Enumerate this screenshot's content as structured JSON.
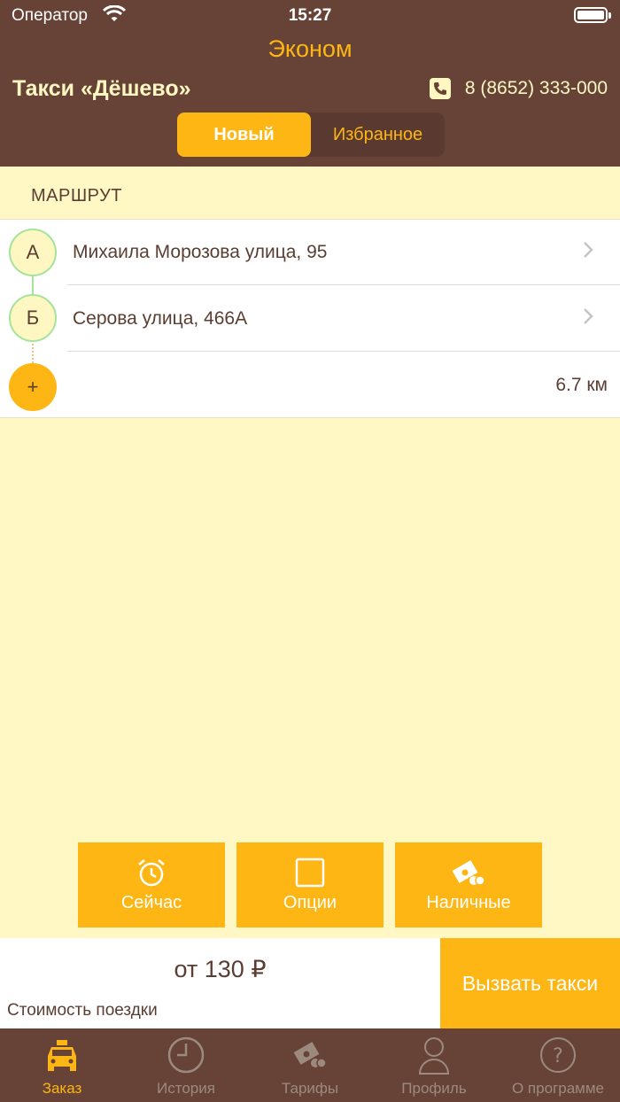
{
  "status_bar": {
    "carrier": "Оператор",
    "time": "15:27"
  },
  "header": {
    "tariff_title": "Эконом",
    "company": "Такси «Дёшево»",
    "phone": "8 (8652) 333-000",
    "segments": [
      {
        "label": "Новый",
        "active": true
      },
      {
        "label": "Избранное",
        "active": false
      }
    ]
  },
  "route": {
    "section_title": "МАРШРУТ",
    "points": [
      {
        "marker": "А",
        "address": "Михаила Морозова улица, 95"
      },
      {
        "marker": "Б",
        "address": "Серова улица, 466А"
      }
    ],
    "add_marker": "+",
    "distance": "6.7 км"
  },
  "options": [
    {
      "label": "Сейчас",
      "icon": "alarm-clock-icon"
    },
    {
      "label": "Опции",
      "icon": "checkbox-icon"
    },
    {
      "label": "Наличные",
      "icon": "cash-icon"
    }
  ],
  "footer": {
    "price": "от 130 ₽",
    "price_label": "Стоимость поездки",
    "call_button": "Вызвать такси"
  },
  "tabs": [
    {
      "label": "Заказ",
      "icon": "taxi-icon",
      "active": true
    },
    {
      "label": "История",
      "icon": "clock-icon",
      "active": false
    },
    {
      "label": "Тарифы",
      "icon": "tariff-icon",
      "active": false
    },
    {
      "label": "Профиль",
      "icon": "profile-icon",
      "active": false
    },
    {
      "label": "О программе",
      "icon": "help-icon",
      "active": false
    }
  ],
  "colors": {
    "brown": "#674337",
    "accent": "#FDB614",
    "cream": "#FFF8C4",
    "point_border": "#A6E39B"
  }
}
